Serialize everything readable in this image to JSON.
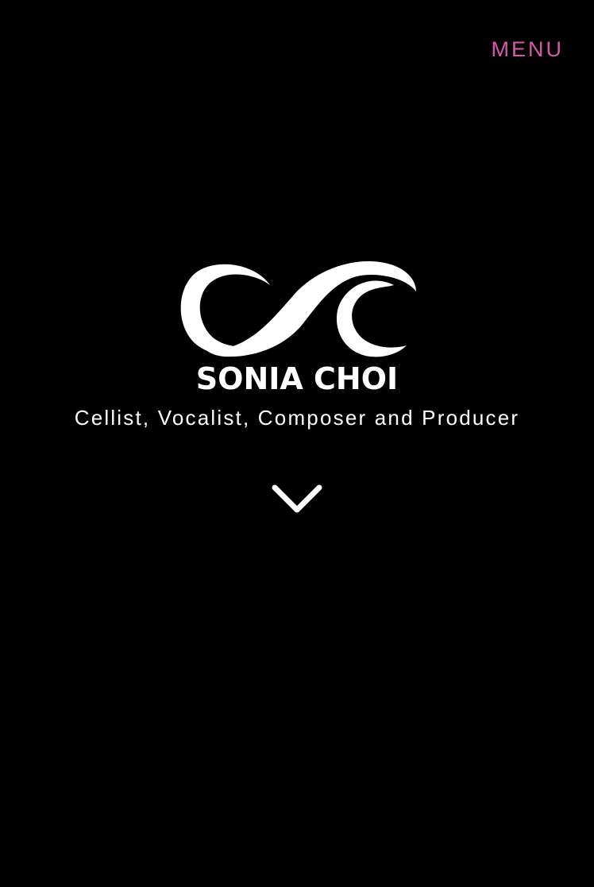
{
  "header": {
    "menu_label": "MENU"
  },
  "hero": {
    "logo_text": "SONIA CHOI",
    "tagline": "Cellist, Vocalist, Composer and Producer",
    "scroll_icon": "chevron-down-icon"
  },
  "colors": {
    "background": "#000000",
    "accent": "#d65aa8",
    "text": "#ffffff"
  }
}
